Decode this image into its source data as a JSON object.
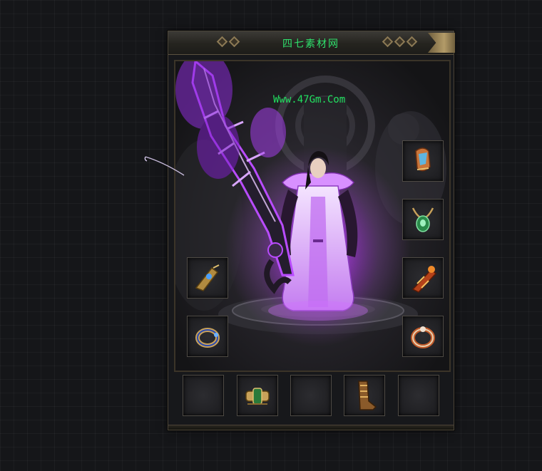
{
  "window": {
    "title": "四七素材网",
    "watermark_url": "Www.47Gm.Com"
  },
  "colors": {
    "title_green": "#2fe06c",
    "panel_border": "#4a4438",
    "aura_purple": "#b94cff",
    "gold": "#c9a25a"
  },
  "character": {
    "weapon_icon": "greatsword-icon",
    "figure_icon": "mage-character-icon"
  },
  "equipment": {
    "right_slots": [
      {
        "icon": "helmet-icon"
      },
      {
        "icon": "necklace-icon"
      },
      {
        "icon": "bracer-icon"
      },
      {
        "icon": "ring-icon"
      }
    ],
    "left_slots": [
      {
        "icon": "bracelet-icon"
      },
      {
        "icon": "ring-icon"
      }
    ],
    "bottom_slots": [
      {
        "icon": "empty-slot"
      },
      {
        "icon": "belt-icon"
      },
      {
        "icon": "empty-slot"
      },
      {
        "icon": "boots-icon"
      },
      {
        "icon": "empty-slot"
      }
    ]
  }
}
